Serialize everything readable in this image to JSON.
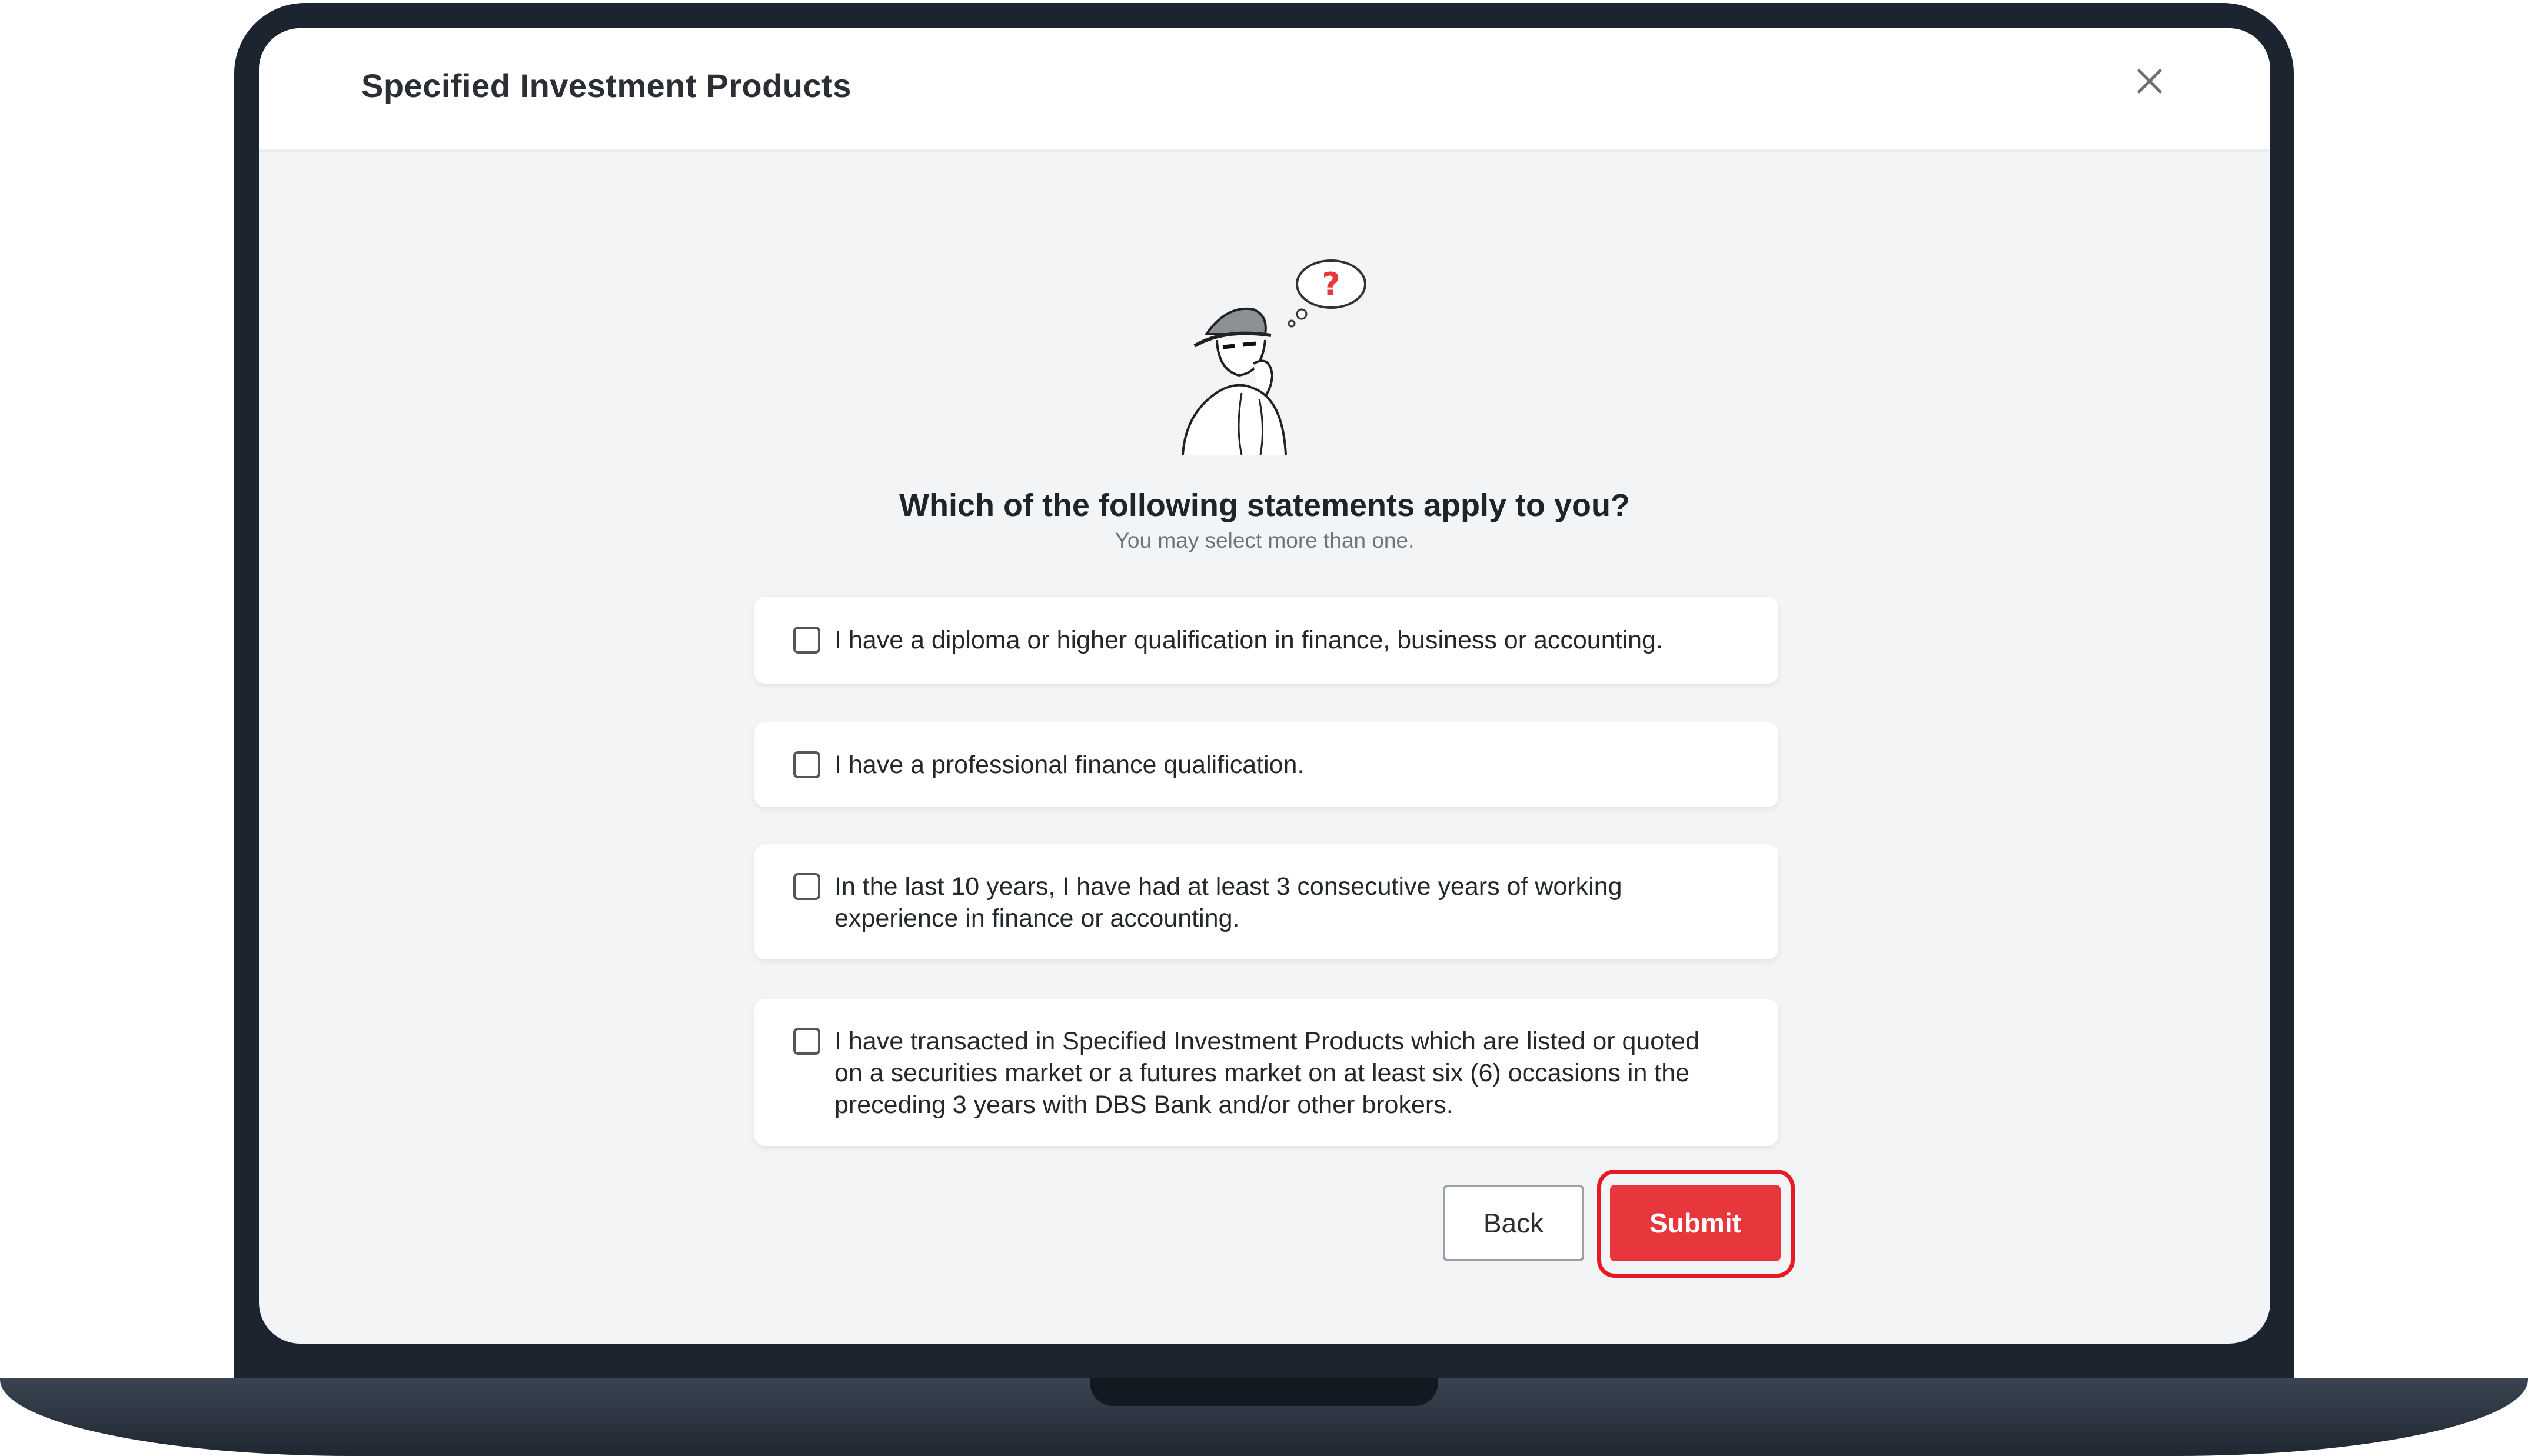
{
  "modal": {
    "title": "Specified Investment Products",
    "close_icon": "close-icon"
  },
  "illustration": {
    "icon": "thinking-person-icon",
    "bubble_text": "?"
  },
  "question": {
    "title": "Which of the following statements apply to you?",
    "hint": "You may select more than one."
  },
  "options": [
    {
      "label": "I have a diploma or higher qualification in finance, business or accounting.",
      "checked": false
    },
    {
      "label": "I have a professional finance qualification.",
      "checked": false
    },
    {
      "label": "In the last 10 years, I have had at least 3 consecutive years of working experience in finance or accounting.",
      "checked": false
    },
    {
      "label": "I have transacted in Specified Investment Products which are listed or quoted on a securities market or a futures market on at least six (6) occasions in the preceding 3 years with DBS Bank and/or other brokers.",
      "checked": false
    }
  ],
  "actions": {
    "back_label": "Back",
    "submit_label": "Submit"
  },
  "colors": {
    "accent": "#e8363d",
    "highlight": "#e51b23",
    "device": "#1c2430"
  }
}
